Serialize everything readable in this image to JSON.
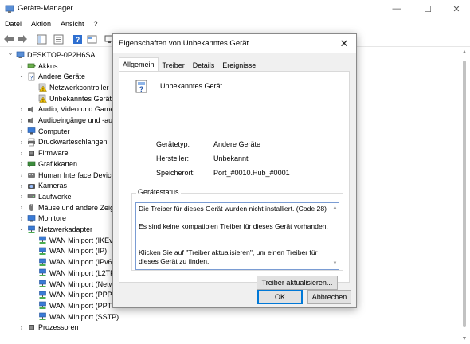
{
  "window": {
    "title": "Geräte-Manager",
    "minimize": "—",
    "maximize": "☐",
    "close": "✕"
  },
  "menu": [
    "Datei",
    "Aktion",
    "Ansicht",
    "?"
  ],
  "toolbar": {
    "icons": [
      "back-arrow-icon",
      "forward-arrow-icon",
      "show-hide-icon",
      "properties-icon",
      "help-icon",
      "view-icon",
      "monitor-icon"
    ]
  },
  "tree": [
    {
      "label": "DESKTOP-0P2H6SA",
      "level": 0,
      "expander": "open",
      "icon": "computer-icon"
    },
    {
      "label": "Akkus",
      "level": 1,
      "expander": "closed",
      "icon": "battery-icon"
    },
    {
      "label": "Andere Geräte",
      "level": 1,
      "expander": "open",
      "icon": "unknown-device-icon"
    },
    {
      "label": "Netzwerkcontroller",
      "level": 2,
      "expander": "none",
      "icon": "warning-device-icon"
    },
    {
      "label": "Unbekanntes Gerät",
      "level": 2,
      "expander": "none",
      "icon": "warning-device-icon"
    },
    {
      "label": "Audio, Video und Game",
      "level": 1,
      "expander": "closed",
      "icon": "speaker-icon"
    },
    {
      "label": "Audioeingänge und -au",
      "level": 1,
      "expander": "closed",
      "icon": "speaker-icon"
    },
    {
      "label": "Computer",
      "level": 1,
      "expander": "closed",
      "icon": "monitor-icon"
    },
    {
      "label": "Druckwarteschlangen",
      "level": 1,
      "expander": "closed",
      "icon": "printer-icon"
    },
    {
      "label": "Firmware",
      "level": 1,
      "expander": "closed",
      "icon": "chip-icon"
    },
    {
      "label": "Grafikkarten",
      "level": 1,
      "expander": "closed",
      "icon": "display-adapter-icon"
    },
    {
      "label": "Human Interface Devices",
      "level": 1,
      "expander": "closed",
      "icon": "hid-icon"
    },
    {
      "label": "Kameras",
      "level": 1,
      "expander": "closed",
      "icon": "camera-icon"
    },
    {
      "label": "Laufwerke",
      "level": 1,
      "expander": "closed",
      "icon": "disk-drive-icon"
    },
    {
      "label": "Mäuse und andere Zeige",
      "level": 1,
      "expander": "closed",
      "icon": "mouse-icon"
    },
    {
      "label": "Monitore",
      "level": 1,
      "expander": "closed",
      "icon": "monitor-icon"
    },
    {
      "label": "Netzwerkadapter",
      "level": 1,
      "expander": "open",
      "icon": "network-adapter-icon"
    },
    {
      "label": "WAN Miniport (IKEv2",
      "level": 2,
      "expander": "none",
      "icon": "network-adapter-icon"
    },
    {
      "label": "WAN Miniport (IP)",
      "level": 2,
      "expander": "none",
      "icon": "network-adapter-icon"
    },
    {
      "label": "WAN Miniport (IPv6)",
      "level": 2,
      "expander": "none",
      "icon": "network-adapter-icon"
    },
    {
      "label": "WAN Miniport (L2TP",
      "level": 2,
      "expander": "none",
      "icon": "network-adapter-icon"
    },
    {
      "label": "WAN Miniport (Netw",
      "level": 2,
      "expander": "none",
      "icon": "network-adapter-icon"
    },
    {
      "label": "WAN Miniport (PPPO",
      "level": 2,
      "expander": "none",
      "icon": "network-adapter-icon"
    },
    {
      "label": "WAN Miniport (PPTP",
      "level": 2,
      "expander": "none",
      "icon": "network-adapter-icon"
    },
    {
      "label": "WAN Miniport (SSTP)",
      "level": 2,
      "expander": "none",
      "icon": "network-adapter-icon"
    },
    {
      "label": "Prozessoren",
      "level": 1,
      "expander": "closed",
      "icon": "chip-icon"
    }
  ],
  "dialog": {
    "title": "Eigenschaften von Unbekanntes Gerät",
    "close": "✕",
    "tabs": [
      "Allgemein",
      "Treiber",
      "Details",
      "Ereignisse"
    ],
    "active_tab": "Allgemein",
    "device_name": "Unbekanntes Gerät",
    "properties": [
      {
        "label": "Gerätetyp:",
        "value": "Andere Geräte"
      },
      {
        "label": "Hersteller:",
        "value": "Unbekannt"
      },
      {
        "label": "Speicherort:",
        "value": "Port_#0010.Hub_#0001"
      }
    ],
    "status_group_title": "Gerätestatus",
    "status_lines": [
      "Die Treiber für dieses Gerät wurden nicht installiert. (Code 28)",
      "",
      "Es sind keine kompatiblen Treiber für dieses Gerät vorhanden.",
      "",
      "",
      "Klicken Sie auf \"Treiber aktualisieren\", um einen Treiber für dieses Gerät zu finden."
    ],
    "update_driver_button": "Treiber aktualisieren...",
    "ok_button": "OK",
    "cancel_button": "Abbrechen"
  },
  "colors": {
    "accent": "#0078d7",
    "warning": "#f2c200",
    "dialog_bg": "#f0f0f0"
  }
}
